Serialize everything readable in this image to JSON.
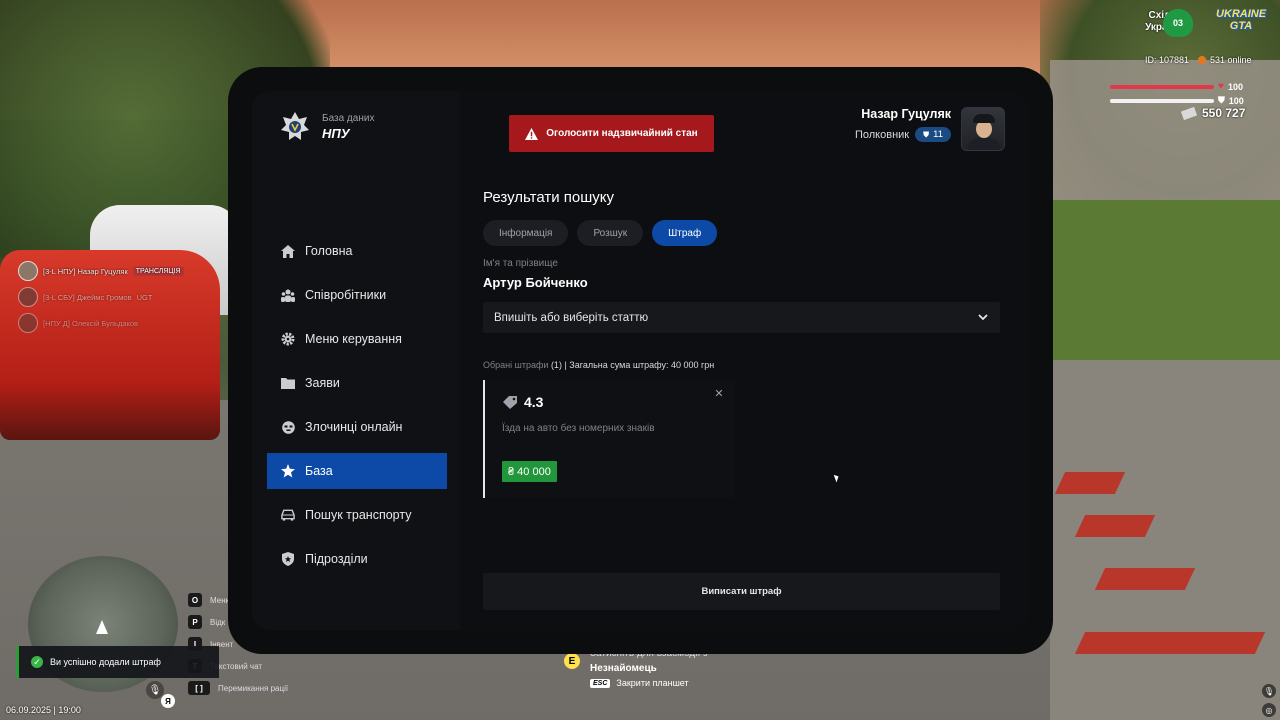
{
  "hud": {
    "region_line1": "Східна",
    "region_line2": "Україна",
    "region_badge": "03",
    "logo_line1": "UKRAINE",
    "logo_line2": "GTA",
    "player_id": "ID: 107881",
    "online": "531 online",
    "health": "100",
    "armor": "100",
    "money": "550 727",
    "icons": [
      "heart-icon",
      "shield-icon",
      "cash-icon"
    ]
  },
  "chat": [
    {
      "text": "[3-L НПУ] Назар Гуцуляк",
      "tag": "ТРАНСЛЯЦІЯ"
    },
    {
      "text": "[3-L СБУ] Джеймс Громов",
      "tag": "UGT"
    },
    {
      "text": "[НПУ Д] Олексій Бульдаков",
      "tag": ""
    }
  ],
  "keys": [
    {
      "key": "O",
      "label": "Меню"
    },
    {
      "key": "P",
      "label": "Відк"
    },
    {
      "key": "I",
      "label": "Інвент"
    },
    {
      "key": "T",
      "label": "Текстовий чат"
    },
    {
      "key": "[  ]",
      "label": "Перемикання рації"
    }
  ],
  "toast": "Ви успішно додали штраф",
  "datetime": "06.09.2025 | 19:00",
  "mic_badge": "Я",
  "interaction": {
    "key": "E",
    "line1": "Затисніть для взаємодії з",
    "line2": "Незнайомець",
    "esc_key": "ESC",
    "esc_label": "Закрити планшет"
  },
  "tablet": {
    "brand": {
      "subtitle": "База даних",
      "title": "НПУ"
    },
    "emergency_button": "Оголосити надзвичайний стан",
    "profile": {
      "name": "Назар Гуцуляк",
      "rank": "Полковник",
      "level": "11"
    },
    "nav": [
      {
        "label": "Головна",
        "icon": "home-icon",
        "active": false
      },
      {
        "label": "Співробітники",
        "icon": "people-icon",
        "active": false
      },
      {
        "label": "Меню керування",
        "icon": "gear-icon",
        "active": false
      },
      {
        "label": "Заяви",
        "icon": "folder-icon",
        "active": false
      },
      {
        "label": "Злочинці онлайн",
        "icon": "mask-icon",
        "active": false
      },
      {
        "label": "База",
        "icon": "star-icon",
        "active": true
      },
      {
        "label": "Пошук транспорту",
        "icon": "car-icon",
        "active": false
      },
      {
        "label": "Підрозділи",
        "icon": "shield-icon",
        "active": false
      }
    ],
    "content": {
      "title": "Результати пошуку",
      "tabs": [
        "Інформація",
        "Розшук",
        "Штраф"
      ],
      "active_tab": "Штраф",
      "name_label": "Ім'я та прізвище",
      "person_name": "Артур Бойченко",
      "article_placeholder": "Впишіть або виберіть статтю",
      "summary_label": "Обрані штрафи",
      "summary_count": "(1)",
      "summary_total": "| Загальна сума штрафу: 40 000 грн",
      "fine": {
        "code": "4.3",
        "description": "Їзда на авто без номерних знаків",
        "amount": "₴ 40 000"
      },
      "submit_button": "Виписати штраф"
    }
  },
  "colors": {
    "accent_blue": "#0d4aa8",
    "emergency_red": "#a5181c",
    "amount_green": "#21963a",
    "panel_bg": "#0d0e11"
  }
}
